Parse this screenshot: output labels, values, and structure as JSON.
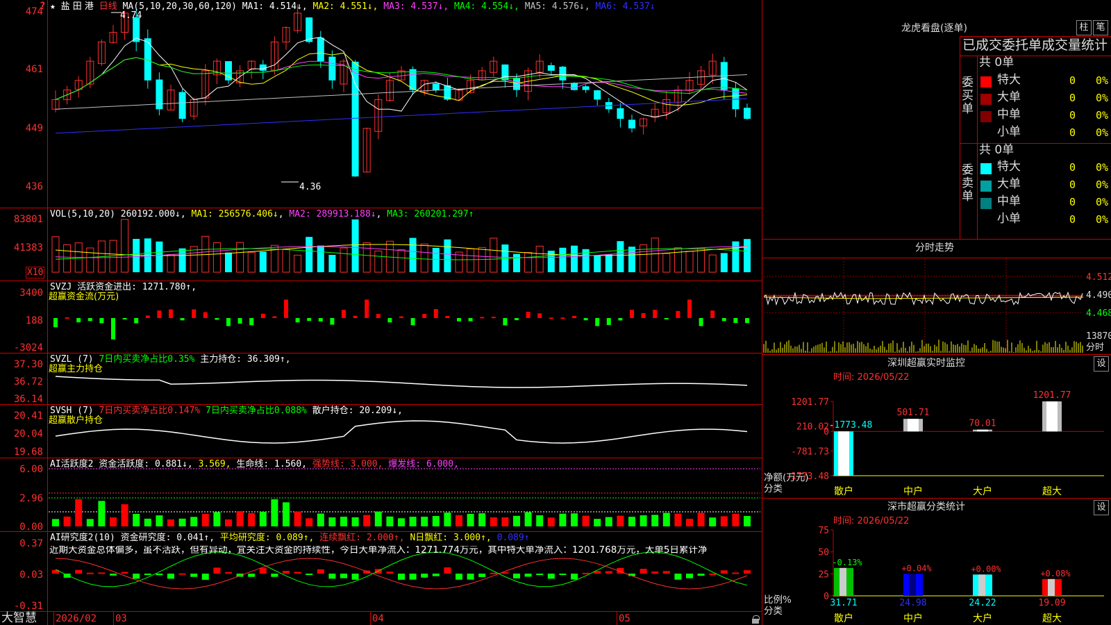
{
  "stock": {
    "star": "★",
    "name": "盐 田 港",
    "period": "日线",
    "q_icon": "?"
  },
  "main_panel": {
    "ma_header": "MA(5,10,20,30,60,120)",
    "ma_items": [
      {
        "label": "MA1: 4.514↓",
        "color": "#ffffff"
      },
      {
        "label": "MA2: 4.551↓",
        "color": "#ffff00"
      },
      {
        "label": "MA3: 4.537↓",
        "color": "#ff40ff"
      },
      {
        "label": "MA4: 4.554↓",
        "color": "#00ff00"
      },
      {
        "label": "MA5: 4.576↓",
        "color": "#c0c0c0"
      },
      {
        "label": "MA6: 4.537↓",
        "color": "#3030ff"
      }
    ],
    "y_ticks": [
      "474",
      "461",
      "449",
      "436"
    ],
    "high_mark": "4.74",
    "low_mark": "4.36"
  },
  "vol_panel": {
    "header": "VOL(5,10,20)",
    "value": "260192.000↓",
    "ma1": "MA1: 256576.406↓",
    "ma2": "MA2: 289913.188↓",
    "ma3": "MA3: 260201.297↑",
    "y_ticks": [
      "83801",
      "41383"
    ],
    "unit": "X10"
  },
  "svzj_panel": {
    "header": "SVZJ  活跃资金进出: 1271.780↑,",
    "subtitle": "超赢资金流(万元)",
    "y_ticks": [
      "3400",
      "188",
      "-3024"
    ]
  },
  "svzl_panel": {
    "name": "SVZL (7)",
    "item1": "7日内买卖净占比0.35%",
    "item2": "主力持仓: 36.309↑,",
    "subtitle": "超赢主力持仓",
    "y_ticks": [
      "37.30",
      "36.72",
      "36.14"
    ]
  },
  "svsh_panel": {
    "name": "SVSH (7)",
    "item1": "7日内买卖净占比0.147%",
    "item2": "7日内买卖净占比0.088%",
    "item3": "散户持仓: 20.209↓,",
    "subtitle": "超赢散户持仓",
    "y_ticks": [
      "20.41",
      "20.04",
      "19.68"
    ]
  },
  "ai_active_panel": {
    "name": "AI活跃度2",
    "item1": "资金活跃度: 0.881↓,",
    "item2": "3.569,",
    "item3": "生命线: 1.560,",
    "item4": "强势线: 3.000,",
    "item5": "爆发线: 6.000,",
    "y_ticks": [
      "6.00",
      "2.96",
      "0.00"
    ]
  },
  "ai_research_panel": {
    "name": "AI研究度2(10)",
    "item1": "资金研究度: 0.041↑,",
    "item2": "平均研究度: 0.089↑,",
    "item3": "连续飘红: 2.000↑,",
    "item4": "N日飘红: 3.000↑,",
    "item5": "0.089↑",
    "comment": "近期大资金总体偏多，虽不活跃，但有异动，宜关注大资金的持续性，今日大单净流入：1271.774万元，其中特大单净流入：1201.768万元，大单5日累计净",
    "y_ticks": [
      "0.37",
      "0.03",
      "-0.31"
    ]
  },
  "date_axis": {
    "brand": "大智慧",
    "labels": [
      "2026/02",
      "03",
      "04",
      "05"
    ]
  },
  "dragon_panel": {
    "title": "龙虎看盘(逐单)",
    "btn_column": "柱",
    "btn_pen": "笔",
    "section_title": "已成交委托单成交量统计",
    "buy_label": "委买单",
    "sell_label": "委卖单",
    "buy_total": "共 0单",
    "sell_total": "共 0单",
    "rows": [
      {
        "label": "特大",
        "count": "0",
        "pct": "0%"
      },
      {
        "label": "大单",
        "count": "0",
        "pct": "0%"
      },
      {
        "label": "中单",
        "count": "0",
        "pct": "0%"
      },
      {
        "label": "小单",
        "count": "0",
        "pct": "0%"
      }
    ],
    "buy_colors": [
      "#ff0000",
      "#a00000",
      "#800000",
      "#000000"
    ],
    "sell_colors": [
      "#00ffff",
      "#00a0a0",
      "#008080",
      "#000000"
    ]
  },
  "intraday_panel": {
    "title": "分时走势",
    "prices": [
      "4.512",
      "4.490",
      "4.468"
    ],
    "vol": "13870",
    "vol_unit": "分时"
  },
  "realtime_panel": {
    "title": "深圳超赢实时监控",
    "settings": "设",
    "time": "时间: 2026/05/22",
    "y_ticks": [
      "1201.77",
      "210.02",
      "0",
      "-781.73",
      "-1773.48"
    ],
    "y_label1": "净额(万元)",
    "y_label2": "分类",
    "categories": [
      "散户",
      "中户",
      "大户",
      "超大"
    ]
  },
  "classify_panel": {
    "title": "深市超赢分类统计",
    "settings": "设",
    "time": "时间: 2026/05/22",
    "y_ticks": [
      "75",
      "50",
      "25",
      "0"
    ],
    "y_label1": "比例%",
    "y_label2": "分类",
    "categories": [
      "散户",
      "中户",
      "大户",
      "超大"
    ]
  },
  "chart_data": [
    {
      "type": "bar",
      "title": "深圳超赢实时监控",
      "categories": [
        "散户",
        "中户",
        "大户",
        "超大"
      ],
      "values": [
        -1773.48,
        501.71,
        70.01,
        1201.77
      ],
      "value_labels": [
        "-1773.48",
        "501.71",
        "70.01",
        "1201.77"
      ],
      "ylim": [
        -1773.48,
        1201.77
      ]
    },
    {
      "type": "bar",
      "title": "深市超赢分类统计",
      "categories": [
        "散户",
        "中户",
        "大户",
        "超大"
      ],
      "values": [
        31.71,
        24.98,
        24.22,
        19.09
      ],
      "value_labels": [
        "31.71",
        "24.98",
        "24.22",
        "19.09"
      ],
      "change_labels": [
        "-0.13%",
        "+0.04%",
        "+0.00%",
        "+0.08%"
      ],
      "colors": [
        "#00c000",
        "#0000ff",
        "#00ffff",
        "#ff0000"
      ],
      "ylim": [
        0,
        75
      ]
    }
  ]
}
